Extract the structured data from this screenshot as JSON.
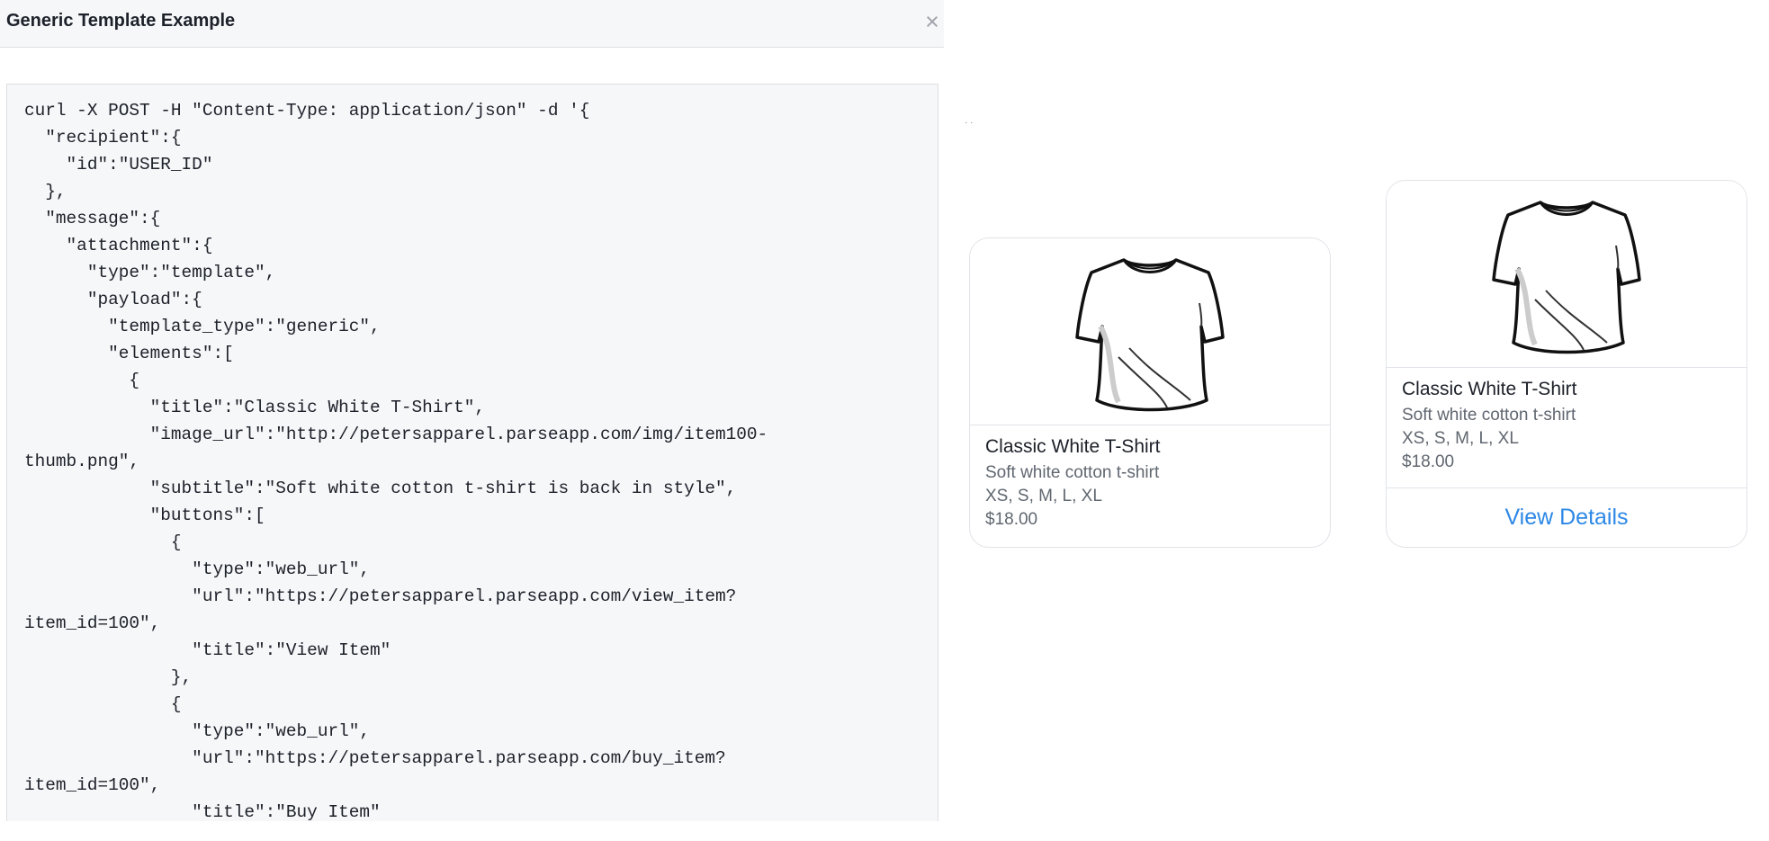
{
  "dialog": {
    "title": "Generic Template Example",
    "close_symbol": "×"
  },
  "code": {
    "lines": [
      "curl -X POST -H \"Content-Type: application/json\" -d '{",
      "  \"recipient\":{",
      "    \"id\":\"USER_ID\"",
      "  },",
      "  \"message\":{",
      "    \"attachment\":{",
      "      \"type\":\"template\",",
      "      \"payload\":{",
      "        \"template_type\":\"generic\",",
      "        \"elements\":[",
      "          {",
      "            \"title\":\"Classic White T-Shirt\",",
      "            \"image_url\":\"http://petersapparel.parseapp.com/img/item100-",
      "thumb.png\",",
      "            \"subtitle\":\"Soft white cotton t-shirt is back in style\",",
      "            \"buttons\":[",
      "              {",
      "                \"type\":\"web_url\",",
      "                \"url\":\"https://petersapparel.parseapp.com/view_item?",
      "item_id=100\",",
      "                \"title\":\"View Item\"",
      "              },",
      "              {",
      "                \"type\":\"web_url\",",
      "                \"url\":\"https://petersapparel.parseapp.com/buy_item?",
      "item_id=100\",",
      "                \"title\":\"Buy Item\""
    ]
  },
  "preview": {
    "stray_mark": "· ·",
    "card_a": {
      "image_icon": "t-shirt-icon",
      "title": "Classic White T-Shirt",
      "subtitle": "Soft white cotton t-shirt",
      "sizes": "XS, S, M, L, XL",
      "price": "$18.00"
    },
    "card_b": {
      "image_icon": "t-shirt-icon",
      "title": "Classic White T-Shirt",
      "subtitle": "Soft white cotton t-shirt",
      "sizes": "XS, S, M, L, XL",
      "price": "$18.00",
      "button_label": "View Details"
    }
  },
  "colors": {
    "header_bg": "#f6f7f9",
    "code_bg": "#f6f7f9",
    "border": "#dddfe2",
    "link_blue": "#2d88e6",
    "secondary_text": "#606770"
  }
}
